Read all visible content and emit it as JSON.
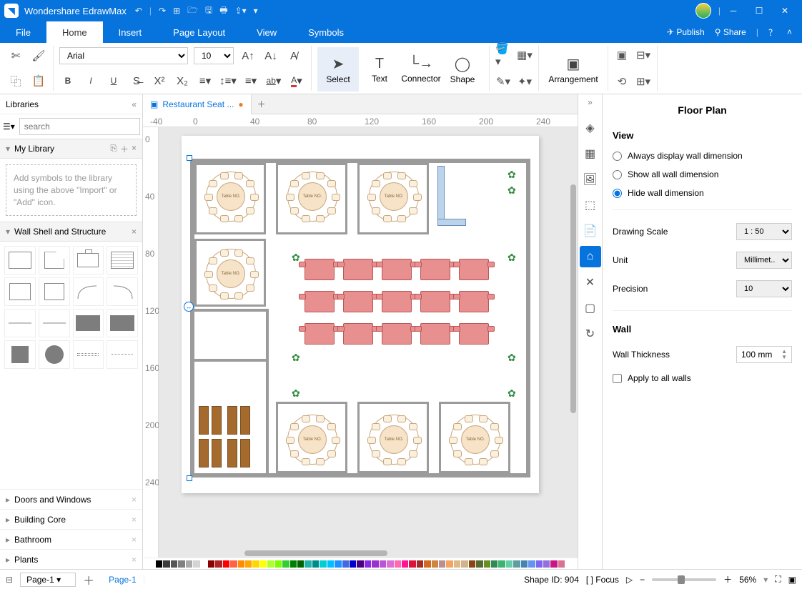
{
  "app": {
    "title": "Wondershare EdrawMax"
  },
  "menubar": {
    "tabs": [
      "File",
      "Home",
      "Insert",
      "Page Layout",
      "View",
      "Symbols"
    ],
    "active": 1,
    "publish": "Publish",
    "share": "Share"
  },
  "ribbon": {
    "font": "Arial",
    "font_size": "10",
    "select": "Select",
    "text": "Text",
    "connector": "Connector",
    "shape": "Shape",
    "arrangement": "Arrangement"
  },
  "libraries": {
    "title": "Libraries",
    "search_placeholder": "search",
    "my_library": "My Library",
    "hint": "Add symbols to the library using the above \"Import\" or \"Add\" icon.",
    "wall_section": "Wall Shell and Structure",
    "categories": [
      "Doors and Windows",
      "Building Core",
      "Bathroom",
      "Plants"
    ]
  },
  "doc": {
    "tab_name": "Restaurant Seat ..."
  },
  "ruler_h": [
    "-40",
    "0",
    "40",
    "80",
    "120",
    "160",
    "200",
    "240"
  ],
  "ruler_v": [
    "0",
    "40",
    "80",
    "120",
    "160",
    "200",
    "240"
  ],
  "floorplan": {
    "table_label": "Table NO."
  },
  "rightpanel": {
    "title": "Floor Plan",
    "view": "View",
    "radios": [
      "Always display wall dimension",
      "Show all wall dimension",
      "Hide wall dimension"
    ],
    "active_radio": 2,
    "drawing_scale": "Drawing Scale",
    "drawing_scale_val": "1 : 50",
    "unit": "Unit",
    "unit_val": "Millimet...",
    "precision": "Precision",
    "precision_val": "10",
    "wall": "Wall",
    "wall_thickness": "Wall Thickness",
    "wall_thickness_val": "100 mm",
    "apply": "Apply to all walls"
  },
  "statusbar": {
    "page_sel": "Page-1",
    "page_tab": "Page-1",
    "shape_id": "Shape ID: 904",
    "focus": "Focus",
    "zoom": "56%"
  },
  "color_palette": [
    "#000000",
    "#3b3b3b",
    "#555555",
    "#808080",
    "#aaaaaa",
    "#d4d4d4",
    "#ffffff",
    "#8b0000",
    "#b22222",
    "#ff0000",
    "#ff6347",
    "#ff8c00",
    "#ffa500",
    "#ffd700",
    "#ffff00",
    "#adff2f",
    "#7cfc00",
    "#32cd32",
    "#008000",
    "#006400",
    "#20b2aa",
    "#008b8b",
    "#00ced1",
    "#00bfff",
    "#1e90ff",
    "#4169e1",
    "#0000cd",
    "#4b0082",
    "#8a2be2",
    "#9932cc",
    "#ba55d3",
    "#da70d6",
    "#ff69b4",
    "#ff1493",
    "#dc143c",
    "#a52a2a",
    "#d2691e",
    "#cd853f",
    "#bc8f8f",
    "#f4a460",
    "#deb887",
    "#d2b48c",
    "#8b4513",
    "#556b2f",
    "#6b8e23",
    "#2e8b57",
    "#3cb371",
    "#66cdaa",
    "#5f9ea0",
    "#4682b4",
    "#6495ed",
    "#7b68ee",
    "#9370db",
    "#c71585",
    "#db7093"
  ]
}
